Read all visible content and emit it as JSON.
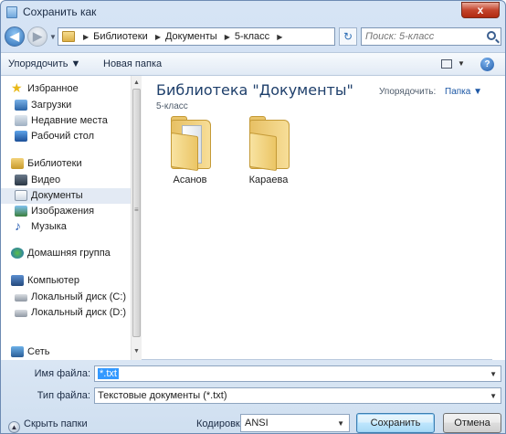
{
  "window": {
    "title": "Сохранить как",
    "close_symbol": "x"
  },
  "address": {
    "crumbs": [
      "Библиотеки",
      "Документы",
      "5-класс"
    ],
    "search_placeholder": "Поиск: 5-класс"
  },
  "toolbar": {
    "organize": "Упорядочить ▼",
    "new_folder": "Новая папка",
    "help": "?"
  },
  "sidebar": {
    "favorites": "Избранное",
    "downloads": "Загрузки",
    "recent": "Недавние места",
    "desktop": "Рабочий стол",
    "libraries": "Библиотеки",
    "video": "Видео",
    "documents": "Документы",
    "images": "Изображения",
    "music": "Музыка",
    "homegroup": "Домашняя группа",
    "computer": "Компьютер",
    "disk_c": "Локальный диск (C:)",
    "disk_d": "Локальный диск (D:)",
    "network": "Сеть"
  },
  "content": {
    "library_title": "Библиотека \"Документы\"",
    "library_subtitle": "5-класс",
    "arrange_label": "Упорядочить:",
    "arrange_value": "Папка ▼",
    "folders": [
      "Асанов",
      "Караева"
    ]
  },
  "form": {
    "filename_label": "Имя файла:",
    "filename_value": "*.txt",
    "filetype_label": "Тип файла:",
    "filetype_value": "Текстовые документы (*.txt)",
    "hide_folders": "Скрыть папки",
    "encoding_label": "Кодировка:",
    "encoding_value": "ANSI",
    "save_button": "Сохранить",
    "cancel_button": "Отмена"
  }
}
